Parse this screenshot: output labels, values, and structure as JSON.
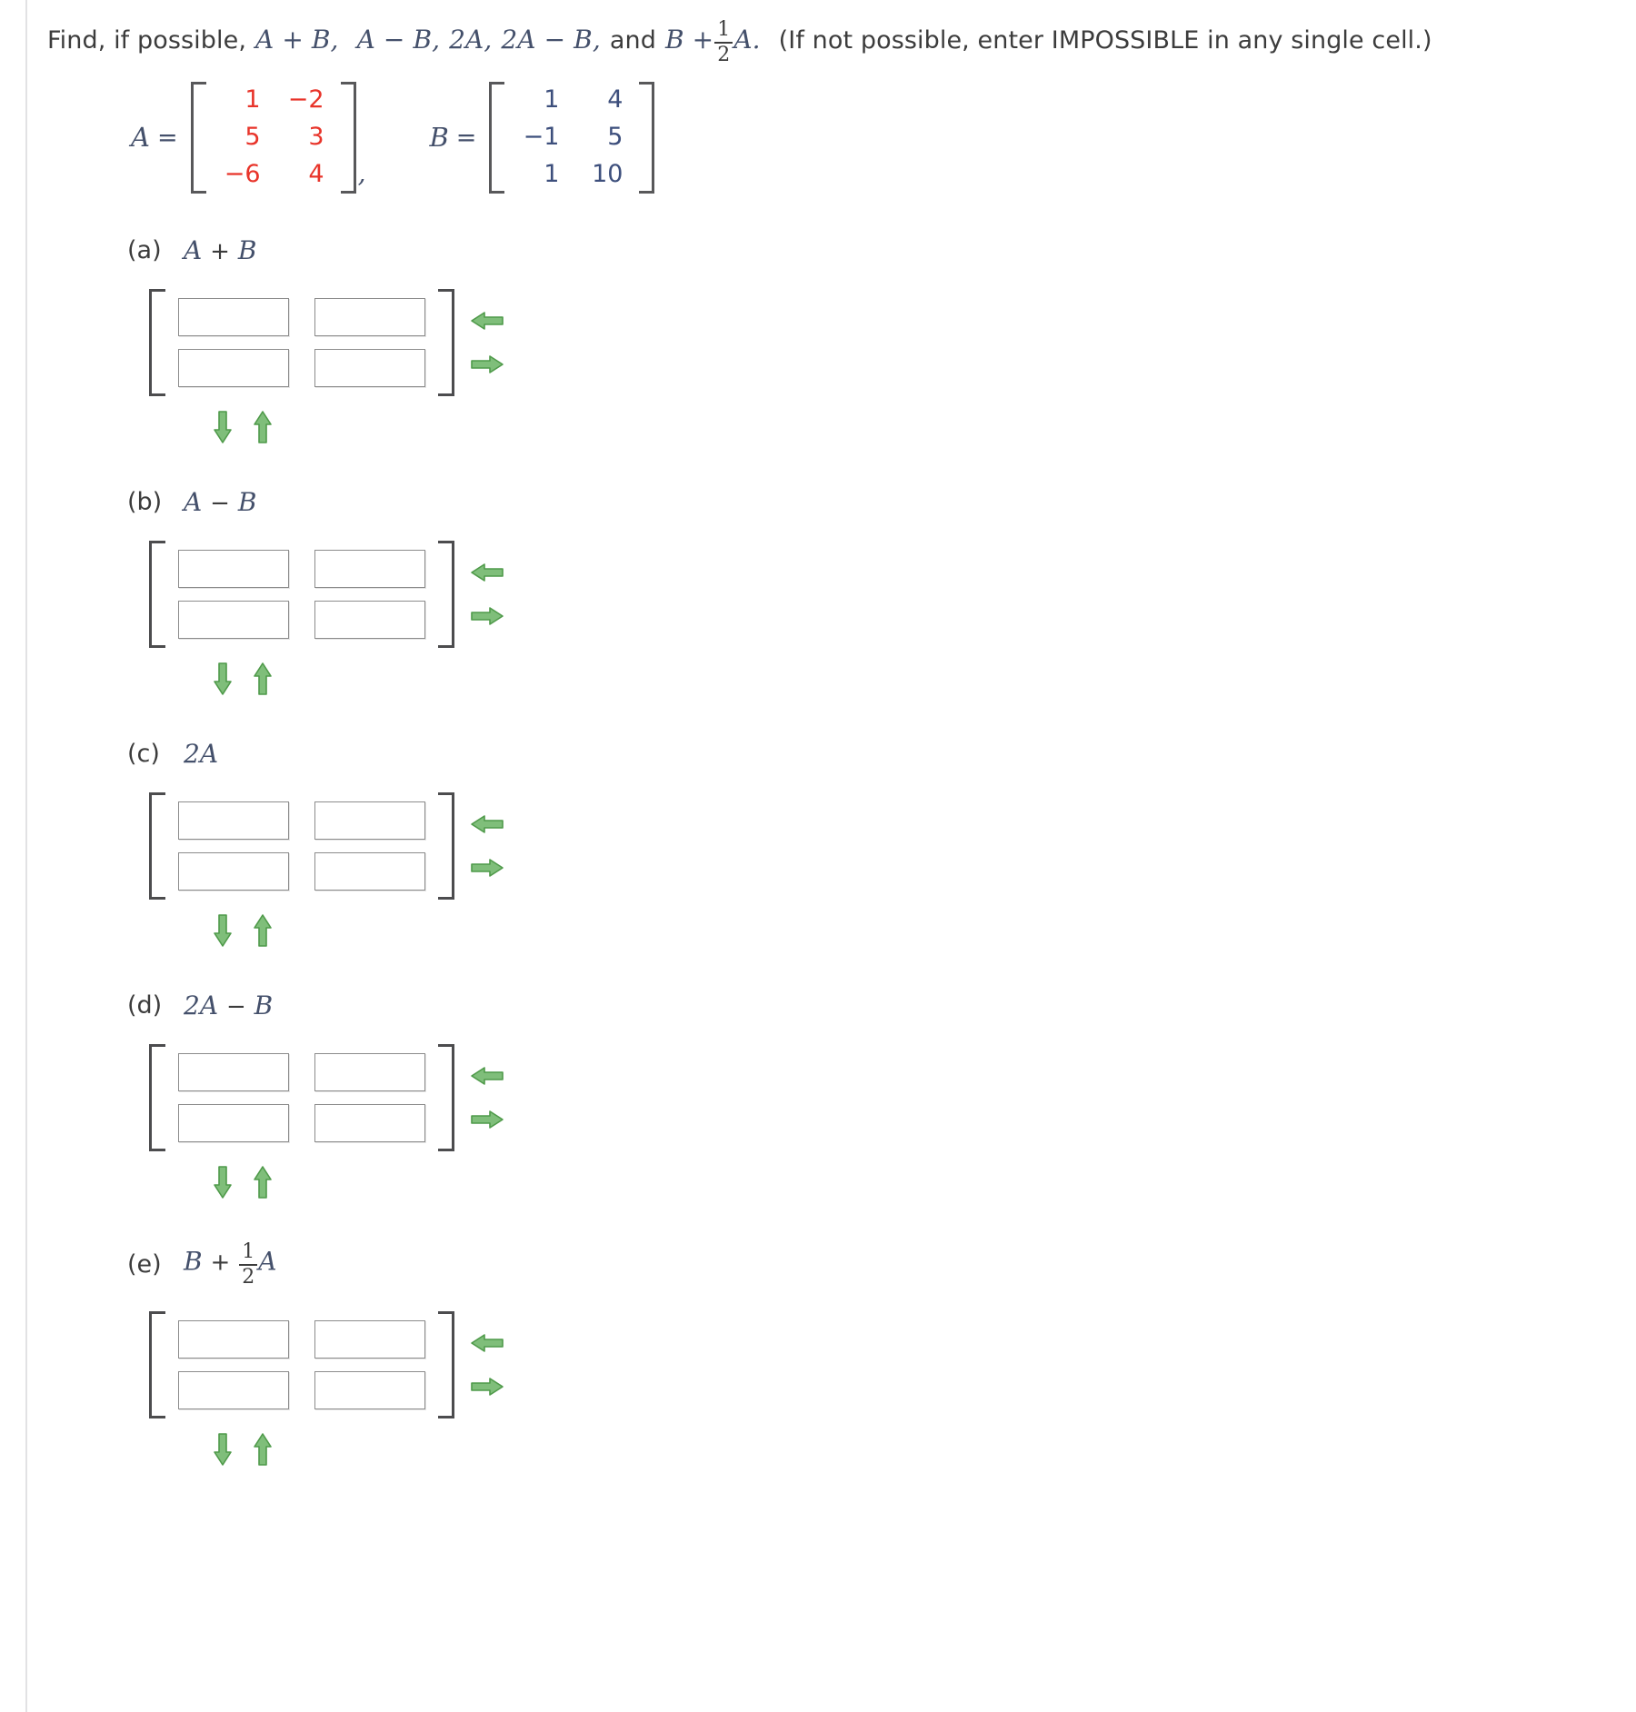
{
  "prompt": {
    "lead": "Find, if possible,",
    "items": [
      "A + B,",
      "A − B,",
      "2A,",
      "2A − B,"
    ],
    "and": "and",
    "last_base": "B +",
    "last_num": "1",
    "last_den": "2",
    "last_var": "A.",
    "note": "(If not possible, enter IMPOSSIBLE in any single cell.)"
  },
  "given": {
    "a": {
      "label": "A",
      "equals": "=",
      "color": "#e8342a",
      "rows": [
        [
          "1",
          "−2"
        ],
        [
          "5",
          "3"
        ],
        [
          "−6",
          "4"
        ]
      ]
    },
    "separator": ",",
    "b": {
      "label": "B",
      "equals": "=",
      "color": "#3d4f7c",
      "rows": [
        [
          "1",
          "4"
        ],
        [
          "−1",
          "5"
        ],
        [
          "1",
          "10"
        ]
      ]
    }
  },
  "parts": [
    {
      "tag": "(a)",
      "expr_pre": "A",
      "expr_op": "+",
      "expr_post": "B",
      "fraction": null,
      "cells": [
        "",
        "",
        "",
        ""
      ]
    },
    {
      "tag": "(b)",
      "expr_pre": "A",
      "expr_op": "−",
      "expr_post": "B",
      "fraction": null,
      "cells": [
        "",
        "",
        "",
        ""
      ]
    },
    {
      "tag": "(c)",
      "expr_pre": "2A",
      "expr_op": "",
      "expr_post": "",
      "fraction": null,
      "cells": [
        "",
        "",
        "",
        ""
      ]
    },
    {
      "tag": "(d)",
      "expr_pre": "2A",
      "expr_op": "−",
      "expr_post": "B",
      "fraction": null,
      "cells": [
        "",
        "",
        "",
        ""
      ]
    },
    {
      "tag": "(e)",
      "expr_pre": "B",
      "expr_op": "+",
      "expr_post": "A",
      "fraction": {
        "num": "1",
        "den": "2"
      },
      "cells": [
        "",
        "",
        "",
        ""
      ]
    }
  ],
  "controls": {
    "left_arrow": "left-arrow",
    "right_arrow": "right-arrow",
    "down_arrow": "down-arrow",
    "up_arrow": "up-arrow",
    "arrow_color": "#63a85e",
    "cell_placeholder": ""
  }
}
